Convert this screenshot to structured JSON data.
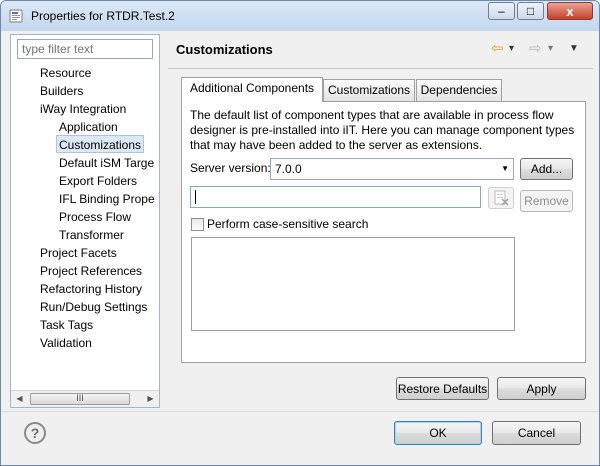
{
  "window": {
    "title": "Properties for RTDR.Test.2",
    "minimize_glyph": "–",
    "maximize_glyph": "□",
    "close_glyph": "x"
  },
  "sidebar": {
    "filter_placeholder": "type filter text",
    "items": [
      {
        "label": "Resource",
        "level": 0
      },
      {
        "label": "Builders",
        "level": 0
      },
      {
        "label": "iWay Integration",
        "level": 0
      },
      {
        "label": "Application",
        "level": 1
      },
      {
        "label": "Customizations",
        "level": 1,
        "selected": true
      },
      {
        "label": "Default iSM Targe",
        "level": 1
      },
      {
        "label": "Export Folders",
        "level": 1
      },
      {
        "label": "IFL Binding Prope",
        "level": 1
      },
      {
        "label": "Process Flow",
        "level": 1
      },
      {
        "label": "Transformer",
        "level": 1
      },
      {
        "label": "Project Facets",
        "level": 0
      },
      {
        "label": "Project References",
        "level": 0
      },
      {
        "label": "Refactoring History",
        "level": 0
      },
      {
        "label": "Run/Debug Settings",
        "level": 0
      },
      {
        "label": "Task Tags",
        "level": 0
      },
      {
        "label": "Validation",
        "level": 0
      }
    ],
    "scroll_left": "◀",
    "scroll_right": "▶",
    "scroll_grip": "III"
  },
  "page": {
    "title": "Customizations",
    "nav": {
      "back_icon": "⇦",
      "back_menu": "▾",
      "forward_icon": "⇨",
      "forward_menu": "▾",
      "view_menu": "▼"
    }
  },
  "tabs": [
    {
      "label": "Additional Components",
      "active": true
    },
    {
      "label": "Customizations",
      "active": false
    },
    {
      "label": "Dependencies",
      "active": false
    }
  ],
  "panel": {
    "description": "The default list of component types that are available in process flow designer is pre-installed into iIT. Here you can manage component types that may have been added to the server as extensions.",
    "server_version_label": "Server version:",
    "server_version_value": "7.0.0",
    "add_button": "Add...",
    "search_value": "",
    "remove_button": "Remove",
    "case_sensitive_label": "Perform case-sensitive search",
    "case_sensitive_checked": false
  },
  "buttons": {
    "restore_defaults": "Restore Defaults",
    "apply": "Apply",
    "ok": "OK",
    "cancel": "Cancel"
  },
  "help_glyph": "?",
  "colors": {
    "selection_bg": "#dde8f5",
    "back_arrow": "#e8a02a",
    "titlebar": "#c3d7ee"
  }
}
